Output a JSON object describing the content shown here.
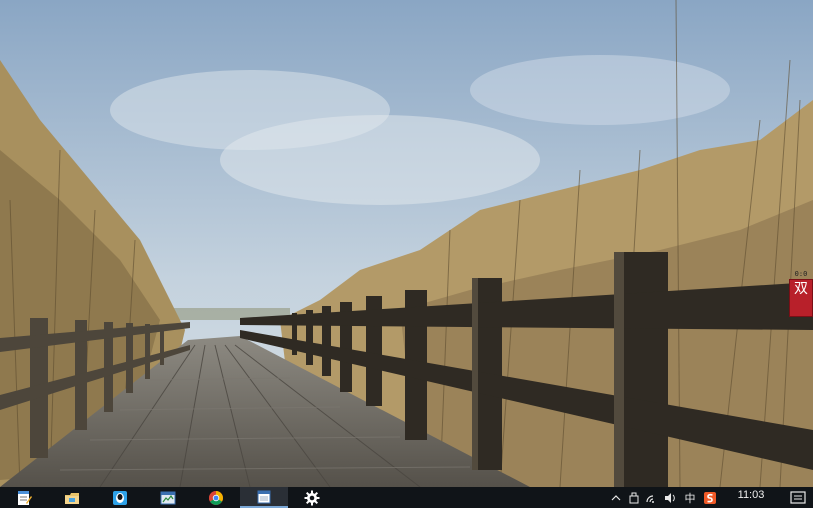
{
  "desktop": {
    "wallpaper": "boardwalk-reeds",
    "colors": {
      "sky_top": "#7f9cbc",
      "sky_bottom": "#d6e0e8",
      "reed": "#b29866",
      "reed_dark": "#6a5634",
      "boardwalk": "#6e6a62",
      "rail": "#3a332a"
    }
  },
  "float_widget": {
    "numbers": "0:0",
    "badge_text": "双"
  },
  "taskbar": {
    "background": "#101418",
    "apps": [
      {
        "icon": "notepad-icon"
      },
      {
        "icon": "file-explorer-icon"
      },
      {
        "icon": "qq-icon"
      },
      {
        "icon": "task-manager-icon"
      },
      {
        "icon": "chrome-icon"
      },
      {
        "icon": "window-app-icon",
        "active": true
      },
      {
        "icon": "settings-gear-icon"
      }
    ],
    "tray": {
      "icons": [
        "chevron-up-icon",
        "usb-device-icon",
        "network-icon",
        "volume-icon"
      ],
      "ime_label": "中",
      "app_tray_icon": "sogou-input-icon",
      "clock_time": "11:03",
      "notification_icon": "action-center-icon"
    }
  }
}
